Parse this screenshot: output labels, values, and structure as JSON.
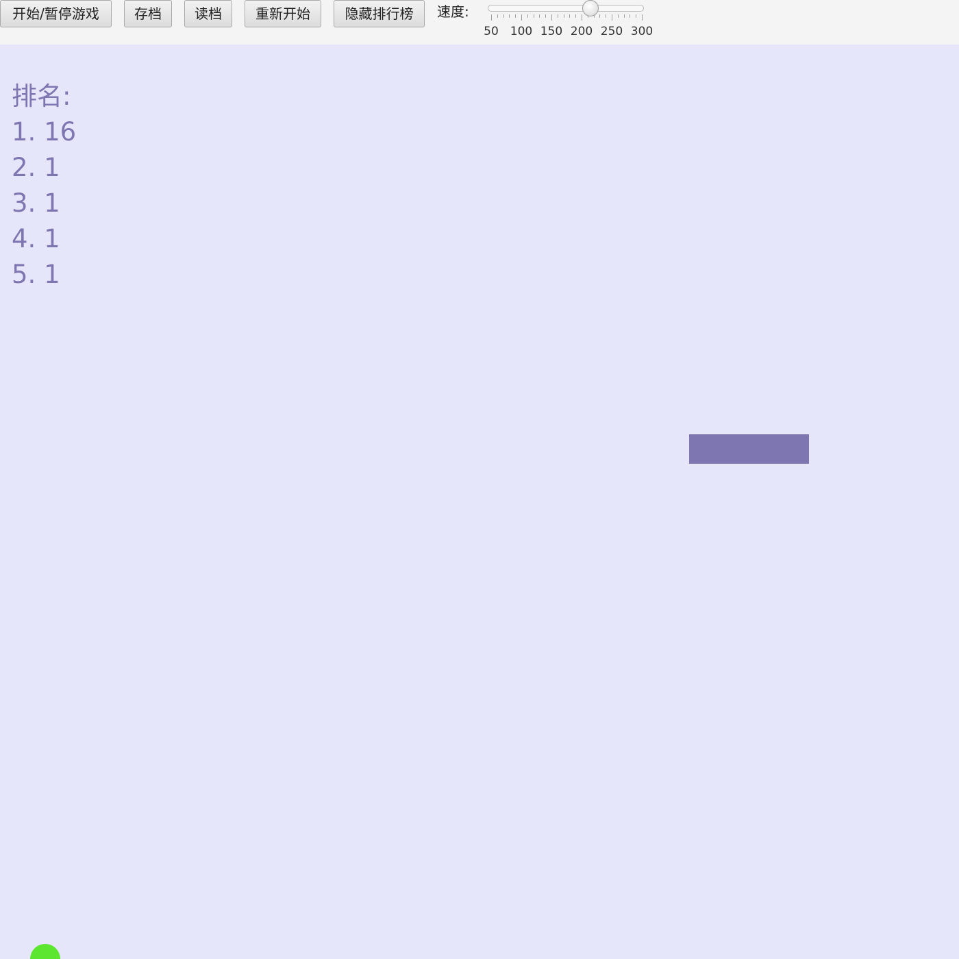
{
  "toolbar": {
    "buttons": [
      {
        "id": "start-pause",
        "label": "开始/暂停游戏"
      },
      {
        "id": "save",
        "label": "存档"
      },
      {
        "id": "load",
        "label": "读档"
      },
      {
        "id": "restart",
        "label": "重新开始"
      },
      {
        "id": "hide-leaderboard",
        "label": "隐藏排行榜"
      }
    ],
    "speed": {
      "label": "速度:",
      "min": 50,
      "max": 300,
      "value": 215,
      "tick_labels": [
        "50",
        "100",
        "150",
        "200",
        "250",
        "300"
      ]
    }
  },
  "leaderboard": {
    "title": "排名:",
    "entries": [
      "1. 16",
      "2. 1",
      "3. 1",
      "4. 1",
      "5. 1"
    ]
  },
  "colors": {
    "background": "#e6e6fa",
    "toolbar": "#f4f4f4",
    "paddle": "#7d76b0",
    "ball": "#5ce62f",
    "leaderboard_text": "#7d76b0"
  }
}
